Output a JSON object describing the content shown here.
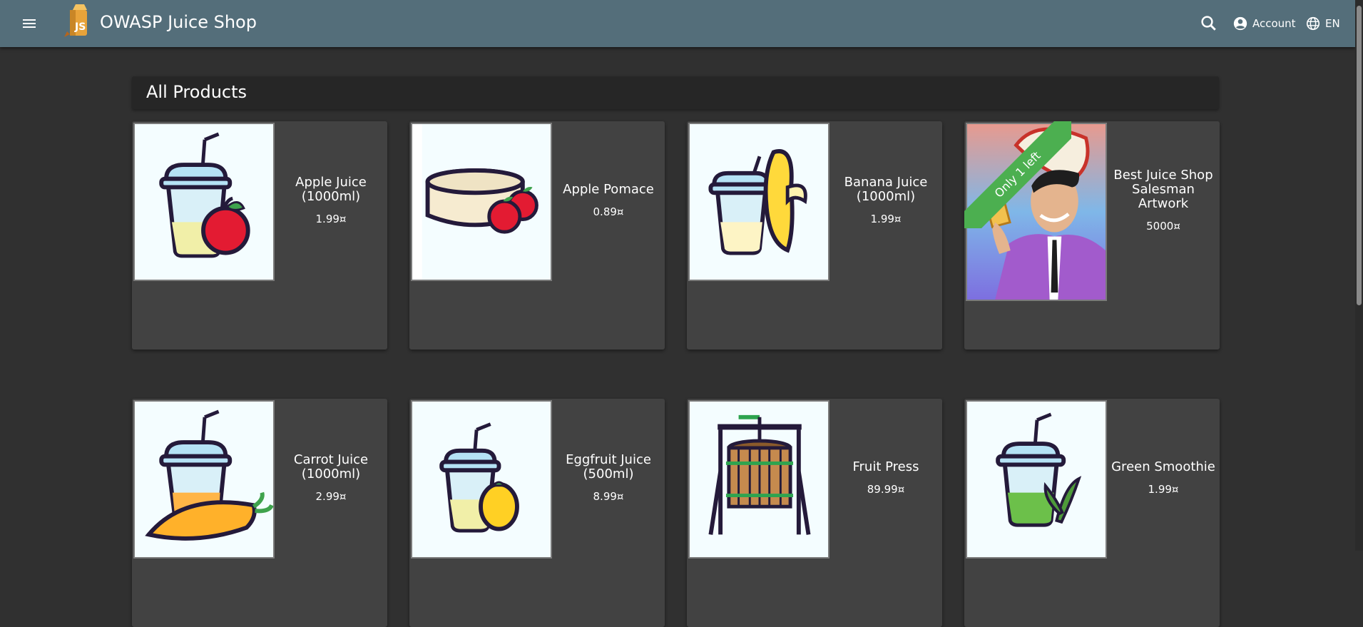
{
  "header": {
    "title": "OWASP Juice Shop",
    "menu_icon": "menu-icon",
    "search_icon": "search-icon",
    "account_label": "Account",
    "language_label": "EN"
  },
  "main": {
    "heading": "All Products",
    "products": [
      {
        "name": "Apple Juice (1000ml)",
        "price": "1.99¤",
        "image": "apple-juice"
      },
      {
        "name": "Apple Pomace",
        "price": "0.89¤",
        "image": "apple-pomace"
      },
      {
        "name": "Banana Juice (1000ml)",
        "price": "1.99¤",
        "image": "banana-juice"
      },
      {
        "name": "Best Juice Shop Salesman Artwork",
        "price": "5000¤",
        "image": "salesman-artwork",
        "ribbon": "Only 1 left"
      },
      {
        "name": "Carrot Juice (1000ml)",
        "price": "2.99¤",
        "image": "carrot-juice"
      },
      {
        "name": "Eggfruit Juice (500ml)",
        "price": "8.99¤",
        "image": "eggfruit-juice"
      },
      {
        "name": "Fruit Press",
        "price": "89.99¤",
        "image": "fruit-press"
      },
      {
        "name": "Green Smoothie",
        "price": "1.99¤",
        "image": "green-smoothie"
      }
    ]
  },
  "colors": {
    "toolbar": "#546e7a",
    "background": "#303030",
    "card": "#424242",
    "ribbon": "#4caf50"
  }
}
